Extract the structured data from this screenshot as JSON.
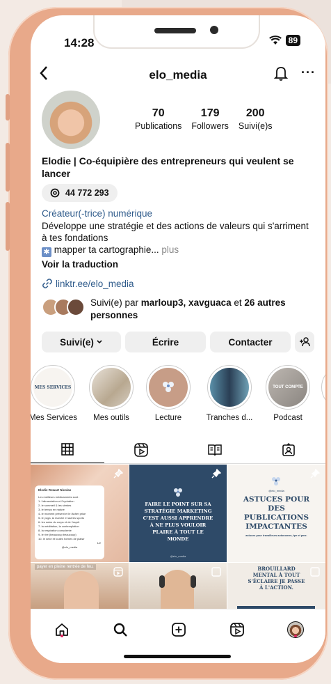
{
  "status": {
    "time": "14:28",
    "battery": "89"
  },
  "header": {
    "username": "elo_media"
  },
  "profile": {
    "stats": [
      {
        "num": "70",
        "label": "Publications"
      },
      {
        "num": "179",
        "label": "Followers"
      },
      {
        "num": "200",
        "label": "Suivi(e)s"
      }
    ],
    "name": "Elodie | Co-équipière des entrepreneurs qui veulent se lancer",
    "threads_count": "44 772 293",
    "category": "Créateur(-trice) numérique",
    "bio_line1": "Développe une stratégie et des actions de valeurs qui s'arriment à tes fondations",
    "bio_line2": "mapper ta cartographie...",
    "bio_more": "plus",
    "translate": "Voir la traduction",
    "link": "linktr.ee/elo_media",
    "followed_prefix": "Suivi(e) par",
    "followed_names": "marloup3, xavguaca",
    "followed_and": "et",
    "followed_rest": "26 autres personnes"
  },
  "buttons": {
    "follow": "Suivi(e)",
    "write": "Écrire",
    "contact": "Contacter"
  },
  "highlights": [
    "Mes Services",
    "Mes outils",
    "Lecture",
    "Tranches d...",
    "Podcast"
  ],
  "highlight_inner": {
    "services": "MES SERVICES",
    "podcast": "TOUT COMPTE"
  },
  "posts": {
    "p1_title": "Elodie Rowart Nicolas",
    "p1_lines": [
      "Les meilleurs médicaments sont :",
      "1- l'alimentation et l'hydration",
      "2- le sommeil & les siestes",
      "3- le temps en nature",
      "4- le moment présent et le lâcher prise",
      "5- le yoga, la marche et autres sports",
      "6- les soins du corps et de l'esprit",
      "7- la méditation, la contemplation",
      "8- la respiration consciente",
      "9- le rire (beaucoup beaucoup)",
      "10- le sexe et toutes formes de plaisir"
    ],
    "p1_page": "1/2",
    "p1_handle": "@elo_media",
    "p2_text": "FAIRE LE POINT SUR SA STRATÉGIE MARKETING C'EST AUSSI APPRENDRE À NE PLUS VOULOIR PLAIRE À TOUT LE MONDE",
    "p2_handle": "@elo_media",
    "p3_handle": "@elo_media",
    "p3_title": "ASTUCES POUR DES PUBLICATIONS IMPACTANTES",
    "p3_sub": "astuces pour travailleurs autonomes, tpe et pme.",
    "p4_caption": "payer en pleine rentrée de feu.",
    "p6_text": "BROUILLARD MENTAL À TOUT S'ÉCLAIRE JE PASSE À L'ACTION."
  },
  "colors": {
    "link": "#2f5b8b",
    "navy": "#2e4a68",
    "frame": "#e8a98a",
    "notif": "#e0245e"
  }
}
